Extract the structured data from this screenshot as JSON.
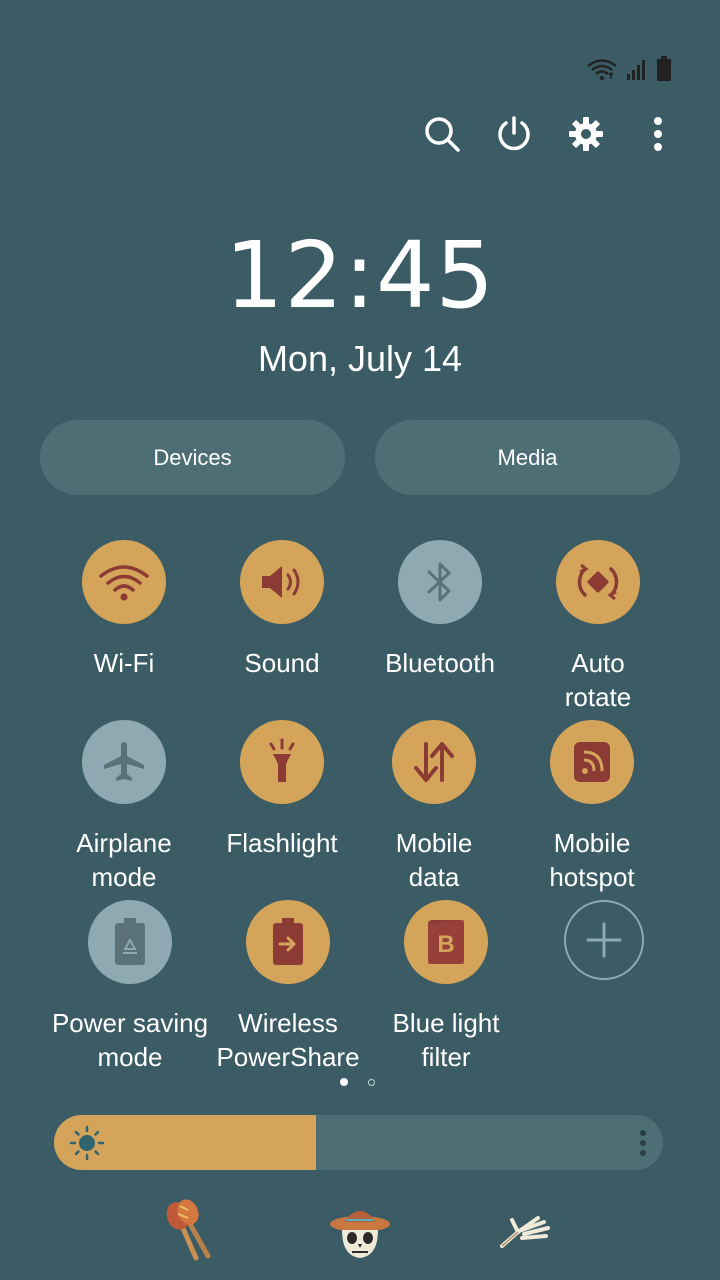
{
  "status_bar": {
    "icons": [
      "wifi-icon",
      "signal-icon",
      "battery-icon"
    ]
  },
  "top_actions": [
    "search-icon",
    "power-icon",
    "settings-icon",
    "more-vert-icon"
  ],
  "clock": {
    "time": "12:45",
    "date": "Mon, July 14"
  },
  "pills": {
    "devices": "Devices",
    "media": "Media"
  },
  "tiles": [
    {
      "label": "Wi-Fi",
      "icon": "wifi-icon",
      "on": true
    },
    {
      "label": "Sound",
      "icon": "volume-icon",
      "on": true
    },
    {
      "label": "Bluetooth",
      "icon": "bluetooth-icon",
      "on": false
    },
    {
      "label": "Auto\nrotate",
      "icon": "auto-rotate-icon",
      "on": true
    },
    {
      "label": "Airplane\nmode",
      "icon": "airplane-icon",
      "on": false
    },
    {
      "label": "Flashlight",
      "icon": "flashlight-icon",
      "on": true
    },
    {
      "label": "Mobile\ndata",
      "icon": "mobile-data-icon",
      "on": true
    },
    {
      "label": "Mobile\nhotspot",
      "icon": "hotspot-icon",
      "on": true
    },
    {
      "label": "Power saving\nmode",
      "icon": "power-saving-icon",
      "on": false
    },
    {
      "label": "Wireless\nPowerShare",
      "icon": "powershare-icon",
      "on": true
    },
    {
      "label": "Blue light\nfilter",
      "icon": "blue-light-filter-icon",
      "on": true
    }
  ],
  "add_tile": {
    "icon": "add-icon"
  },
  "page_indicator": {
    "current": 1,
    "total": 2
  },
  "brightness": {
    "level": 0.43
  },
  "decorations": [
    "maracas-icon",
    "skull-sombrero-icon",
    "skeleton-hand-icon"
  ],
  "colors": {
    "background": "#3b5c64",
    "accent": "#d4a45a",
    "icon_active": "#8b3a34",
    "tile_off": "#8ea9b1",
    "pill": "#4e6e75"
  }
}
